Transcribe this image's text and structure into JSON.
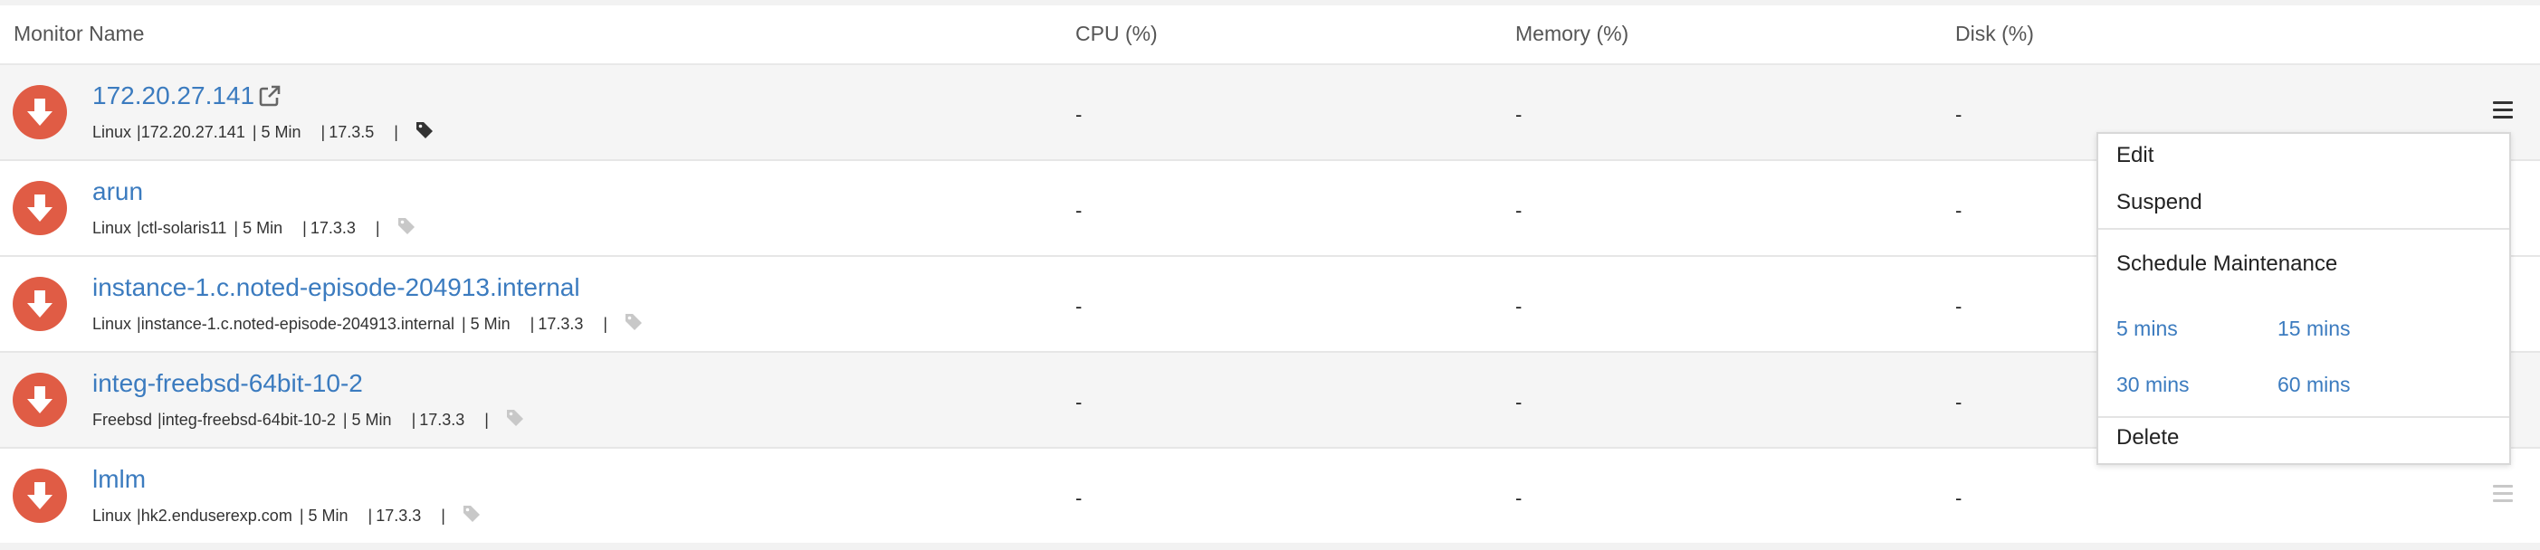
{
  "table": {
    "headers": {
      "monitor_name": "Monitor Name",
      "cpu": "CPU (%)",
      "memory": "Memory (%)",
      "disk": "Disk (%)"
    },
    "rows": [
      {
        "name": "172.20.27.141",
        "meta": {
          "os": "Linux",
          "host": "172.20.27.141",
          "interval": "5 Min",
          "version": "17.3.5",
          "separator": "|"
        },
        "cpu": "-",
        "memory": "-",
        "disk": "-",
        "status": "down-icon",
        "tag_icon_active": true,
        "has_external_link": true
      },
      {
        "name": "arun",
        "meta": {
          "os": "Linux",
          "host": "ctl-solaris11",
          "interval": "5 Min",
          "version": "17.3.3",
          "separator": "|"
        },
        "cpu": "-",
        "memory": "-",
        "disk": "-",
        "status": "down-icon",
        "tag_icon_active": false
      },
      {
        "name": "instance-1.c.noted-episode-204913.internal",
        "meta": {
          "os": "Linux",
          "host": "instance-1.c.noted-episode-204913.internal",
          "interval": "5 Min",
          "version": "17.3.3",
          "separator": "|"
        },
        "cpu": "-",
        "memory": "-",
        "disk": "-",
        "status": "down-icon",
        "tag_icon_active": false
      },
      {
        "name": "integ-freebsd-64bit-10-2",
        "meta": {
          "os": "Freebsd",
          "host": "integ-freebsd-64bit-10-2",
          "interval": "5 Min",
          "version": "17.3.3",
          "separator": "|"
        },
        "cpu": "-",
        "memory": "-",
        "disk": "-",
        "status": "down-icon",
        "tag_icon_active": false
      },
      {
        "name": "lmlm",
        "meta": {
          "os": "Linux",
          "host": "hk2.enduserexp.com",
          "interval": "5 Min",
          "version": "17.3.3",
          "separator": "|"
        },
        "cpu": "-",
        "memory": "-",
        "disk": "-",
        "status": "down-icon",
        "tag_icon_active": false
      }
    ]
  },
  "actions_menu": {
    "edit": "Edit",
    "suspend": "Suspend",
    "schedule_maintenance": "Schedule Maintenance",
    "durations": [
      "5 mins",
      "15 mins",
      "30 mins",
      "60 mins"
    ],
    "delete": "Delete"
  },
  "colors": {
    "status_down": "#e05c45",
    "link": "#3b7bbf",
    "row_alt": "#f5f5f5",
    "icon_dark": "#333333",
    "icon_light": "#c8c8c8"
  }
}
